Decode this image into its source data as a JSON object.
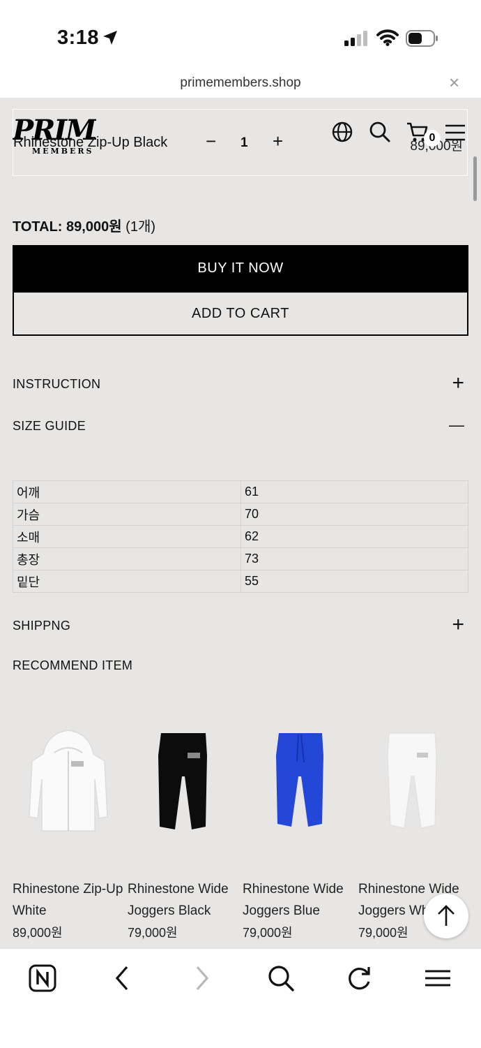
{
  "status_bar": {
    "time": "3:18"
  },
  "url_bar": {
    "url": "primemembers.shop",
    "close_label": "×"
  },
  "header": {
    "cart_count": "0",
    "logo_text": "PRIME MEMBERS"
  },
  "product_row": {
    "name": "Rhinestone Zip-Up Black",
    "qty_minus": "−",
    "quantity": "1",
    "qty_plus": "+",
    "price": "89,000원"
  },
  "total": {
    "label": "TOTAL:",
    "amount": "89,000원",
    "count": "(1개)"
  },
  "buttons": {
    "buy_now": "BUY IT NOW",
    "add_to_cart": "ADD TO CART"
  },
  "accordions": {
    "instruction": {
      "label": "INSTRUCTION",
      "sign": "+"
    },
    "size_guide": {
      "label": "SIZE GUIDE",
      "sign": "—"
    },
    "shipping": {
      "label": "SHIPPNG",
      "sign": "+"
    }
  },
  "size_table": [
    {
      "part": "어깨",
      "value": "61"
    },
    {
      "part": "가슴",
      "value": "70"
    },
    {
      "part": "소매",
      "value": "62"
    },
    {
      "part": "총장",
      "value": "73"
    },
    {
      "part": "밑단",
      "value": "55"
    }
  ],
  "recommend": {
    "title": "RECOMMEND ITEM",
    "items": [
      {
        "name": "Rhinestone Zip-Up White",
        "price": "89,000원",
        "color": "#f7f7f8"
      },
      {
        "name": "Rhinestone Wide Joggers Black",
        "price": "79,000원",
        "color": "#0c0c0c"
      },
      {
        "name": "Rhinestone Wide Joggers Blue",
        "price": "79,000원",
        "color": "#2348d8"
      },
      {
        "name": "Rhinestone Wide Joggers White",
        "price": "79,000원",
        "color": "#f5f5f6"
      }
    ]
  },
  "icons": {
    "top": "arrow-up-icon",
    "toolbar": [
      "naver-home-icon",
      "back-icon",
      "forward-icon",
      "search-icon",
      "reload-icon",
      "menu-icon"
    ]
  }
}
